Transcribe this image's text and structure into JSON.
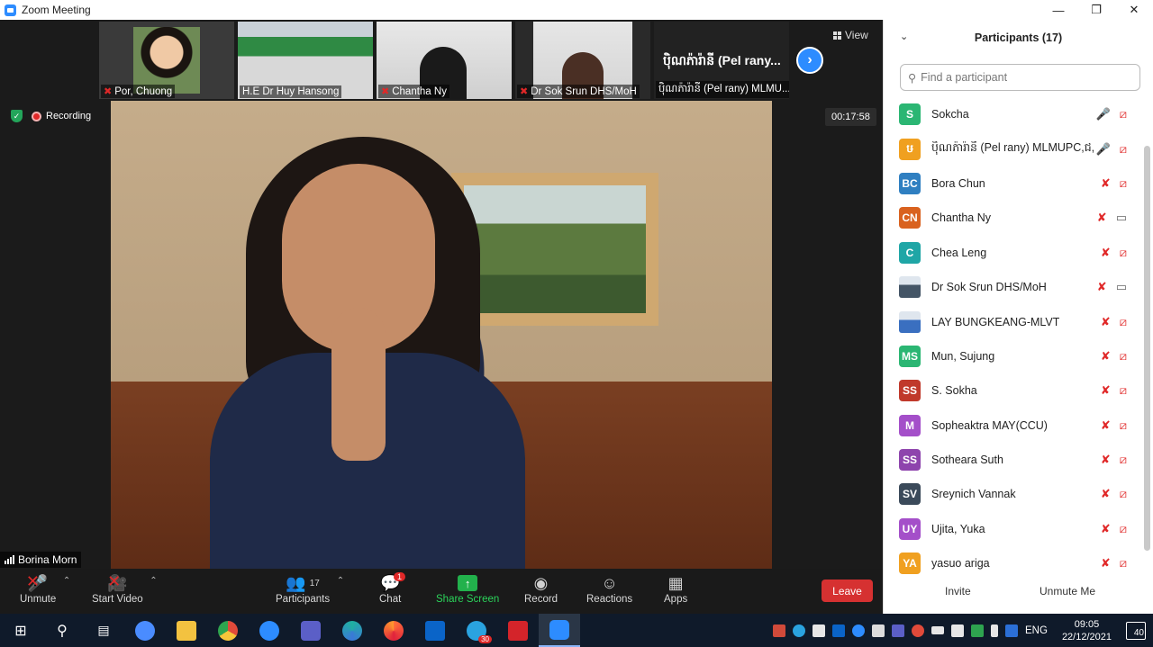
{
  "window": {
    "title": "Zoom Meeting"
  },
  "thumbnails": [
    {
      "name": "Por, Chuong",
      "muted": true
    },
    {
      "name": "H.E Dr Huy Hansong",
      "muted": false
    },
    {
      "name": "Chantha Ny",
      "muted": true
    },
    {
      "name": "Dr Sok Srun DHS/MoH",
      "muted": true
    },
    {
      "name": "ប៉ិណភ៉ារ៉ានី (Pel rany) MLMU...",
      "display": "ប៉ិណភ៉ារ៉ានី (Pel rany...",
      "muted": false
    }
  ],
  "view_label": "View",
  "status": {
    "recording": "Recording",
    "timer": "00:17:58"
  },
  "active_speaker": "Borina Morn",
  "toolbar": {
    "unmute": "Unmute",
    "start_video": "Start Video",
    "participants": "Participants",
    "participants_count": "17",
    "chat": "Chat",
    "chat_badge": "1",
    "share_screen": "Share Screen",
    "record": "Record",
    "reactions": "Reactions",
    "apps": "Apps",
    "leave": "Leave"
  },
  "panel": {
    "title": "Participants (17)",
    "search_placeholder": "Find a participant",
    "participants": [
      {
        "initials": "S",
        "color": "#2bb673",
        "name": "Sokcha",
        "mic": "on",
        "cam": "off"
      },
      {
        "initials": "ឞ",
        "color": "#f0a020",
        "name": "ប៉ិណភ៉ារ៉ានី (Pel rany) MLMUPC,ជ, ...",
        "mic": "on",
        "cam": "off"
      },
      {
        "initials": "BC",
        "color": "#2f7fc1",
        "name": "Bora Chun",
        "mic": "off",
        "cam": "off"
      },
      {
        "initials": "CN",
        "color": "#d9621f",
        "name": "Chantha Ny",
        "mic": "off",
        "cam": "on"
      },
      {
        "initials": "C",
        "color": "#1fa6a6",
        "name": "Chea Leng",
        "mic": "off",
        "cam": "off"
      },
      {
        "initials": "",
        "color": "#445566",
        "name": "Dr Sok Srun DHS/MoH",
        "mic": "off",
        "cam": "on",
        "photo": true
      },
      {
        "initials": "",
        "color": "#3a6fc0",
        "name": "LAY BUNGKEANG-MLVT",
        "mic": "off",
        "cam": "off",
        "photo": true
      },
      {
        "initials": "MS",
        "color": "#2bb673",
        "name": "Mun, Sujung",
        "mic": "off",
        "cam": "off"
      },
      {
        "initials": "SS",
        "color": "#c0392b",
        "name": "S. Sokha",
        "mic": "off",
        "cam": "off"
      },
      {
        "initials": "M",
        "color": "#a44fc9",
        "name": "Sopheaktra MAY(CCU)",
        "mic": "off",
        "cam": "off"
      },
      {
        "initials": "SS",
        "color": "#8e44ad",
        "name": "Sotheara Suth",
        "mic": "off",
        "cam": "off"
      },
      {
        "initials": "SV",
        "color": "#3b4a5a",
        "name": "Sreynich Vannak",
        "mic": "off",
        "cam": "off"
      },
      {
        "initials": "UY",
        "color": "#a44fc9",
        "name": "Ujita, Yuka",
        "mic": "off",
        "cam": "off"
      },
      {
        "initials": "YA",
        "color": "#f0a020",
        "name": "yasuo ariga",
        "mic": "off",
        "cam": "off"
      }
    ],
    "invite": "Invite",
    "unmute_me": "Unmute Me"
  },
  "taskbar": {
    "time": "09:05",
    "date": "22/12/2021",
    "language": "ENG",
    "notification_count": "40",
    "telegram_badge": "30"
  }
}
